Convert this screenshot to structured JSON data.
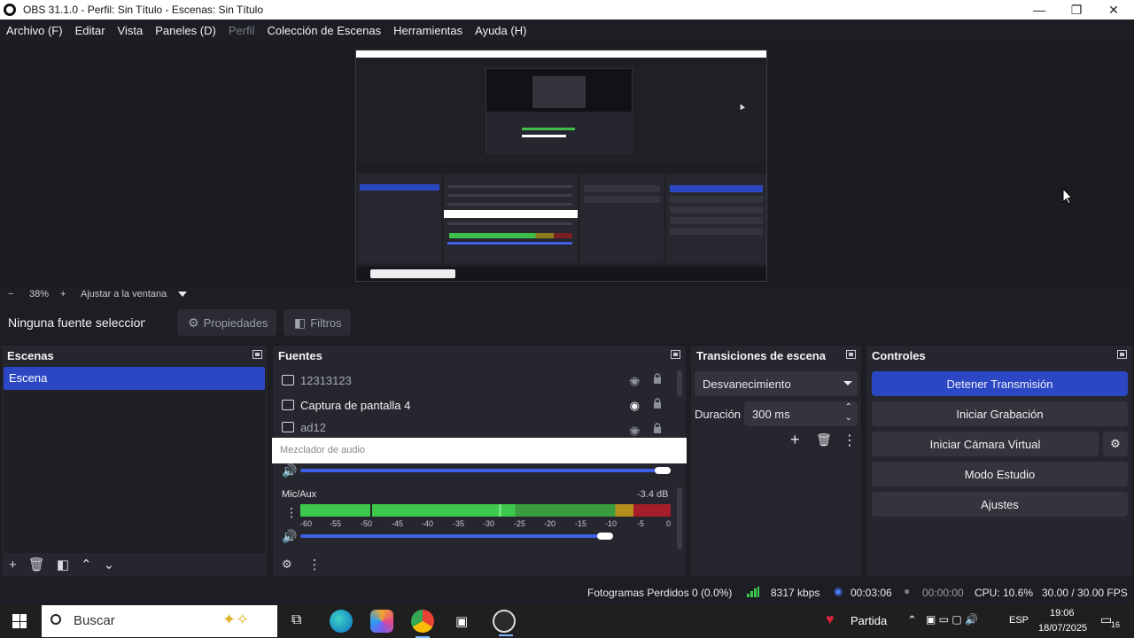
{
  "window": {
    "title": "OBS 31.1.0 - Perfil: Sin Título - Escenas: Sin Título",
    "minimize_icon": "—",
    "maximize_icon": "❐",
    "close_icon": "✕"
  },
  "menu": {
    "archivo": "Archivo (F)",
    "editar": "Editar",
    "vista": "Vista",
    "paneles": "Paneles (D)",
    "perfil": "Perfil",
    "coleccion": "Colección de Escenas",
    "herramientas": "Herramientas",
    "ayuda": "Ayuda (H)"
  },
  "zoom": {
    "minus": "−",
    "value": "38%",
    "plus": "+",
    "fit_label": "Ajustar a la ventana"
  },
  "source_toolbar": {
    "no_source": "Ninguna fuente seleccionada",
    "properties": "Propiedades",
    "filters": "Filtros"
  },
  "scenes": {
    "title": "Escenas",
    "items": [
      "Escena"
    ],
    "selected": "Escena"
  },
  "sources": {
    "title": "Fuentes",
    "items": [
      {
        "name": "12313123",
        "visible": false
      },
      {
        "name": "Captura de pantalla 4",
        "visible": true
      },
      {
        "name": "ad12",
        "visible": false
      }
    ]
  },
  "mixer": {
    "title": "Mezclador de audio",
    "channel_name": "Mic/Aux",
    "channel_db": "-3.4 dB",
    "ticks": [
      "-60",
      "-55",
      "-50",
      "-45",
      "-40",
      "-35",
      "-30",
      "-25",
      "-20",
      "-15",
      "-10",
      "-5",
      "0"
    ]
  },
  "transitions": {
    "title": "Transiciones de escena",
    "selected": "Desvanecimiento",
    "duration_label": "Duración",
    "duration_value": "300 ms"
  },
  "controls": {
    "title": "Controles",
    "stop_stream": "Detener Transmisión",
    "start_recording": "Iniciar Grabación",
    "start_virtual_cam": "Iniciar Cámara Virtual",
    "studio_mode": "Modo Estudio",
    "settings": "Ajustes"
  },
  "status": {
    "dropped_frames": "Fotogramas Perdidos 0 (0.0%)",
    "bitrate": "8317 kbps",
    "stream_time": "00:03:06",
    "record_time": "00:00:00",
    "cpu": "CPU: 10.6%",
    "fps": "30.00 / 30.00 FPS"
  },
  "taskbar": {
    "search_placeholder": "Buscar",
    "game_label": "Partida",
    "language": "ESP",
    "time": "19:06",
    "date": "18/07/2025",
    "notif_count": "16"
  },
  "colors": {
    "accent": "#2c47c4",
    "panel_bg": "#26272e",
    "window_bg": "#1d1e24",
    "meter_green": "#3ec94d",
    "meter_red": "#a51e2a"
  }
}
